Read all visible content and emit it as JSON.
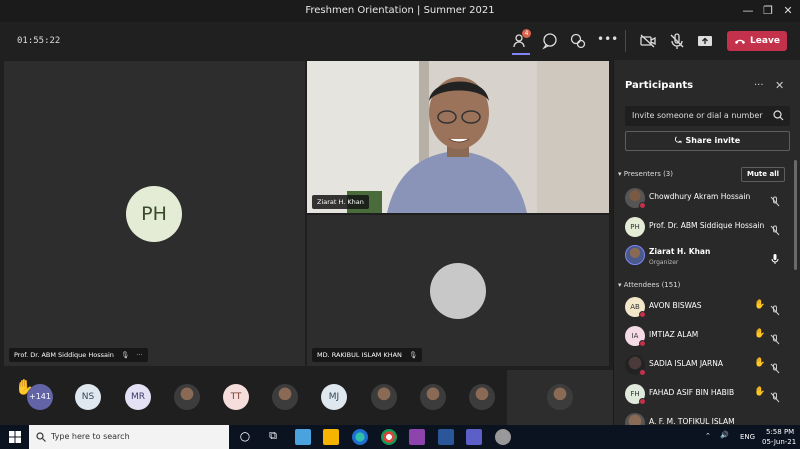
{
  "window": {
    "title": "Freshmen Orientation | Summer 2021"
  },
  "toolbar": {
    "timer": "01:55:22",
    "participants_badge": "4",
    "leave_label": "Leave",
    "colors": {
      "leave": "#c4314b",
      "accent": "#6264a7"
    }
  },
  "stage": {
    "tile1": {
      "initials": "PH",
      "name": "Prof. Dr. ABM Siddique Hossain"
    },
    "tile2": {
      "name": "Ziarat H. Khan"
    },
    "tile3": {
      "name": "MD. RAKIBUL ISLAM KHAN"
    }
  },
  "strip": {
    "more_count": "+141",
    "avatars": [
      "NS",
      "MR",
      "TT",
      "MJ"
    ]
  },
  "panel": {
    "title": "Participants",
    "search_placeholder": "Invite someone or dial a number",
    "share_label": "Share invite",
    "presenters_header": "Presenters (3)",
    "mute_all_label": "Mute all",
    "presenters": [
      {
        "name": "Chowdhury Akram Hossain",
        "initials": ""
      },
      {
        "name": "Prof. Dr. ABM Siddique Hossain",
        "initials": "PH"
      },
      {
        "name": "Ziarat H. Khan",
        "role": "Organizer",
        "initials": ""
      }
    ],
    "attendees_header": "Attendees (151)",
    "attendees": [
      {
        "name": "AVON BISWAS",
        "initials": "AB"
      },
      {
        "name": "IMTIAZ ALAM",
        "initials": "IA"
      },
      {
        "name": "SADIA ISLAM JARNA",
        "initials": ""
      },
      {
        "name": "FAHAD ASIF BIN HABIB",
        "initials": "FH"
      },
      {
        "name": "A. F. M. TOFIKUL ISLAM",
        "initials": ""
      }
    ]
  },
  "taskbar": {
    "search_placeholder": "Type here to search",
    "lang": "ENG",
    "time": "5:58 PM",
    "date": "05-Jun-21"
  }
}
